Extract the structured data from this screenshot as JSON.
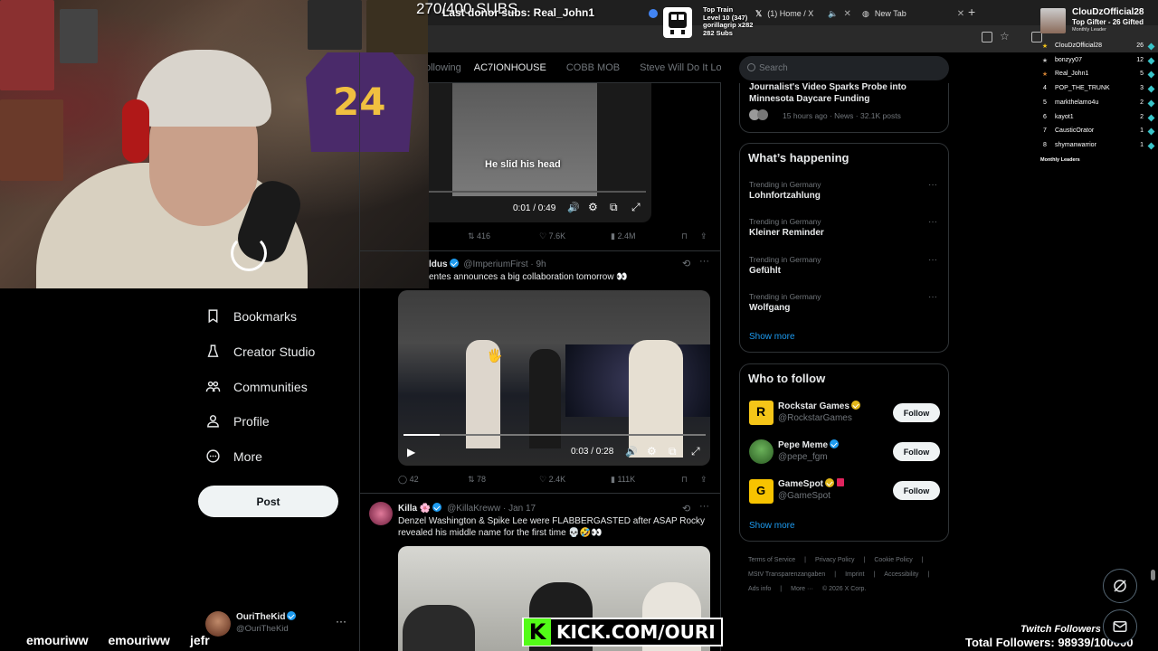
{
  "overlay": {
    "subs_goal": "270/400 SUBS",
    "last_donor": "Last donor subs: Real_John1",
    "hype_train": [
      "Top Train",
      "Level 10  (347)",
      "gorillagrip x282",
      "282 Subs"
    ],
    "kick_url": "KICK.COM/OURI",
    "kick_letter": "K",
    "twitch_followers_label": "Twitch Followers",
    "total_followers": "Total Followers: 98939/100000",
    "chat_names": [
      "emouriww",
      "emouriww",
      "jefr"
    ]
  },
  "browser": {
    "tabs": [
      {
        "label": "(1) Home / X"
      },
      {
        "label": "New Tab"
      }
    ],
    "new_tab": "+"
  },
  "feed": {
    "top_tabs": [
      "ollowing",
      "AC7IONHOUSE",
      "COBB MOB",
      "Steve Will Do It Loyal"
    ],
    "tweet1": {
      "caption": "He slid his head",
      "time": "0:01 / 0:49",
      "replies": "",
      "retweets": "416",
      "likes": "7.6K",
      "views": "2.4M"
    },
    "tweet2": {
      "name": "ldus",
      "handle": "@ImperiumFirst · 9h",
      "text": "entes announces a big collaboration tomorrow 👀",
      "time": "0:03 / 0:28",
      "replies": "42",
      "retweets": "78",
      "likes": "2.4K",
      "views": "111K"
    },
    "tweet3": {
      "name": "Killa 🌸",
      "handle": "@KillaKreww · Jan 17",
      "text": "Denzel Washington & Spike Lee were FLABBERGASTED after ASAP Rocky revealed his middle name for the first time 💀🤣👀"
    }
  },
  "left_nav": {
    "items": [
      {
        "label": "Bookmarks",
        "icon": "bookmark-icon"
      },
      {
        "label": "Creator Studio",
        "icon": "creator-studio-icon"
      },
      {
        "label": "Communities",
        "icon": "communities-icon"
      },
      {
        "label": "Profile",
        "icon": "profile-icon"
      },
      {
        "label": "More",
        "icon": "more-icon"
      }
    ],
    "post_label": "Post",
    "me": {
      "name": "OuriTheKid",
      "handle": "@OuriTheKid",
      "more": "···"
    }
  },
  "right": {
    "search_placeholder": "Search",
    "news": {
      "title": "Journalist's Video Sparks Probe into Minnesota Daycare Funding",
      "meta": "15 hours ago · News · 32.1K posts"
    },
    "happening": {
      "title": "What’s happening",
      "trends": [
        {
          "sub": "Trending in Germany",
          "name": "Lohnfortzahlung"
        },
        {
          "sub": "Trending in Germany",
          "name": "Kleiner Reminder"
        },
        {
          "sub": "Trending in Germany",
          "name": "Gefühlt"
        },
        {
          "sub": "Trending in Germany",
          "name": "Wolfgang"
        }
      ],
      "show_more": "Show more"
    },
    "who_to_follow": {
      "title": "Who to follow",
      "accounts": [
        {
          "name": "Rockstar Games",
          "handle": "@RockstarGames",
          "follow": "Follow"
        },
        {
          "name": "Pepe Meme",
          "handle": "@pepe_fgm",
          "follow": "Follow"
        },
        {
          "name": "GameSpot",
          "handle": "@GameSpot",
          "follow": "Follow"
        }
      ],
      "show_more": "Show more"
    },
    "footer": [
      "Terms of Service",
      "|",
      "Privacy Policy",
      "|",
      "Cookie Policy",
      "|",
      "MStV Transparenzangaben",
      "|",
      "Imprint",
      "|",
      "Accessibility",
      "|",
      "Ads info",
      "|",
      "More ···",
      "© 2026 X Corp."
    ]
  },
  "leaderboard": {
    "top_name": "ClouDzOfficial28",
    "top_sub": "Top Gifter - 26 Gifted",
    "top_sub2": "Monthly Leader",
    "rows": [
      {
        "rank": "★",
        "name": "ClouDzOfficial28",
        "count": "26"
      },
      {
        "rank": "★",
        "name": "bonzyy07",
        "count": "12"
      },
      {
        "rank": "★",
        "name": "Real_John1",
        "count": "5"
      },
      {
        "rank": "4",
        "name": "POP_THE_TRUNK",
        "count": "3"
      },
      {
        "rank": "5",
        "name": "markthelamo4u",
        "count": "2"
      },
      {
        "rank": "6",
        "name": "kayot1",
        "count": "2"
      },
      {
        "rank": "7",
        "name": "CausticOrator",
        "count": "1"
      },
      {
        "rank": "8",
        "name": "shymanwarrior",
        "count": "1"
      }
    ],
    "footer": "Monthly Leaders"
  },
  "colors": {
    "accent": "#1d9bf0",
    "kick_green": "#53fc18",
    "border": "#2f3336"
  }
}
